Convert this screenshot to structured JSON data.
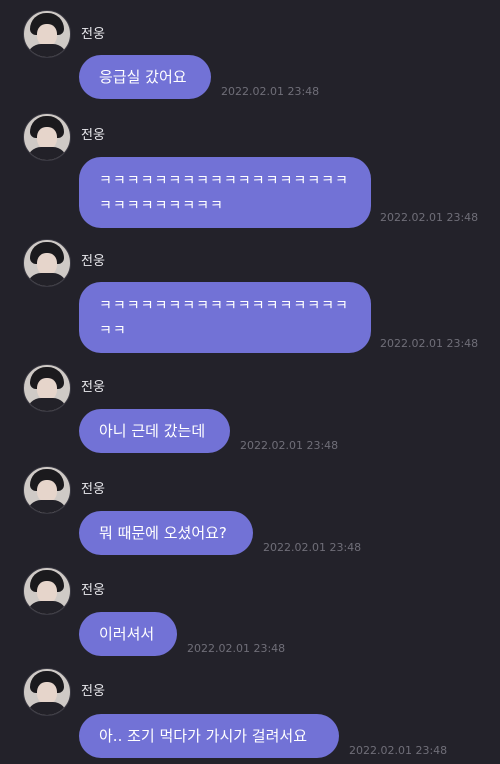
{
  "messages": [
    {
      "sender": "전웅",
      "text": "응급실 갔어요",
      "time": "2022.02.01 23:48"
    },
    {
      "sender": "전웅",
      "text": "ㅋㅋㅋㅋㅋㅋㅋㅋㅋㅋㅋㅋㅋㅋㅋㅋㅋㅋ\nㅋㅋㅋㅋㅋㅋㅋㅋㅋ",
      "time": "2022.02.01 23:48"
    },
    {
      "sender": "전웅",
      "text": "ㅋㅋㅋㅋㅋㅋㅋㅋㅋㅋㅋㅋㅋㅋㅋㅋㅋㅋ\nㅋㅋ",
      "time": "2022.02.01 23:48"
    },
    {
      "sender": "전웅",
      "text": "아니 근데 갔는데",
      "time": "2022.02.01 23:48"
    },
    {
      "sender": "전웅",
      "text": "뭐 때문에 오셨어요?",
      "time": "2022.02.01 23:48"
    },
    {
      "sender": "전웅",
      "text": "이러셔서",
      "time": "2022.02.01 23:48"
    },
    {
      "sender": "전웅",
      "text": "아.. 조기 먹다가 가시가 걸려서요",
      "time": "2022.02.01 23:48"
    }
  ],
  "colors": {
    "background": "#23222a",
    "bubble": "#7272d6",
    "timestamp": "#6f6e78"
  }
}
